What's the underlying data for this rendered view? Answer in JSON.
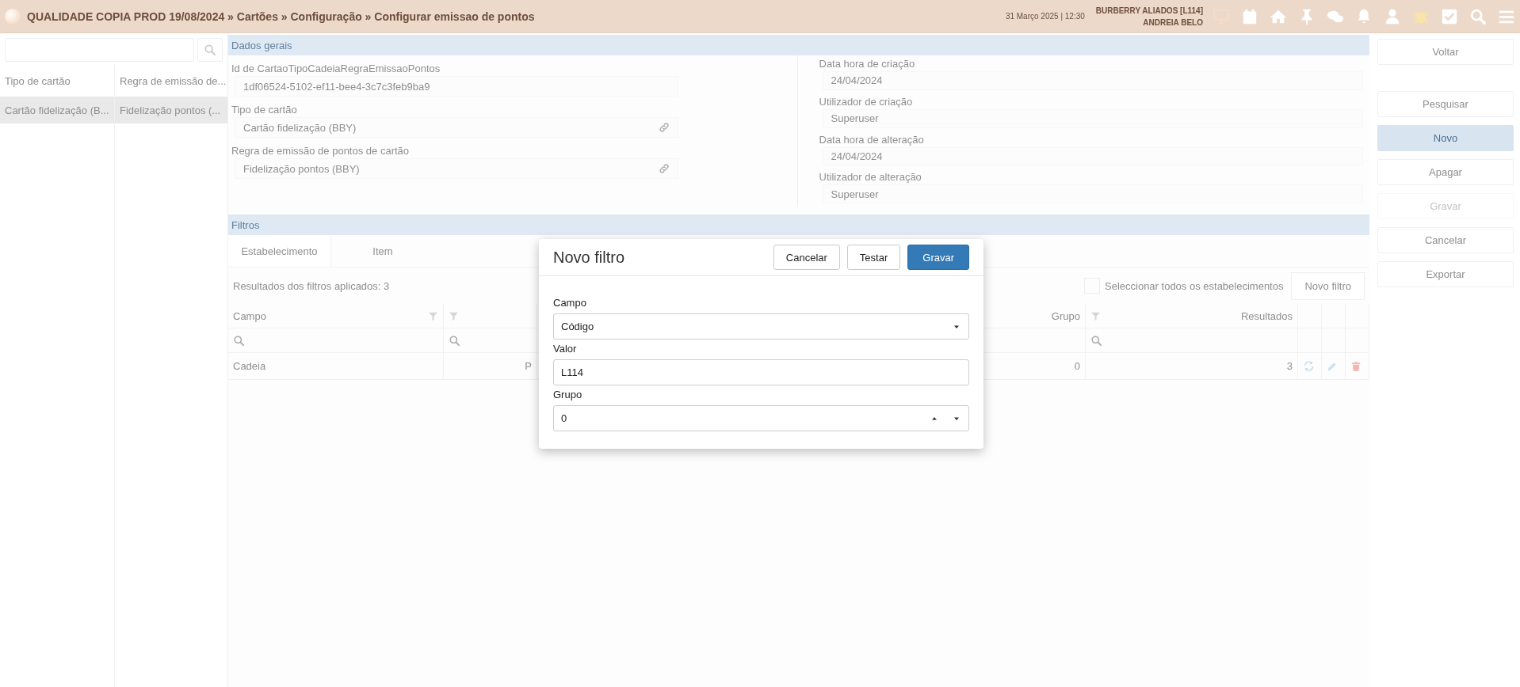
{
  "top_bar": {
    "breadcrumb": "QUALIDADE COPIA PROD 19/08/2024 » Cartões » Configuração » Configurar emissao de pontos",
    "datetime": "31 Março 2025 | 12:30",
    "company": "BURBERRY ALIADOS [L114]",
    "user": "ANDREIA BELO"
  },
  "side_panel": {
    "columns": [
      "Tipo de cartão",
      "Regra de emissão de..."
    ],
    "rows": [
      {
        "cells": [
          "Cartão fidelização (B...",
          "Fidelização pontos (..."
        ],
        "selected": true
      }
    ]
  },
  "dados_gerais": {
    "title": "Dados gerais",
    "left_fields": [
      {
        "label": "Id de CartaoTipoCadeiaRegraEmissaoPontos",
        "value": "1df06524-5102-ef11-bee4-3c7c3feb9ba9",
        "linked": false
      },
      {
        "label": "Tipo de cartão",
        "value": "Cartão fidelização (BBY)",
        "linked": true
      },
      {
        "label": "Regra de emissão de pontos de cartão",
        "value": "Fidelização pontos (BBY)",
        "linked": true
      }
    ],
    "right_fields": [
      {
        "label": "Data hora de criação",
        "value": "24/04/2024"
      },
      {
        "label": "Utilizador de criação",
        "value": "Superuser"
      },
      {
        "label": "Data hora de alteração",
        "value": "24/04/2024"
      },
      {
        "label": "Utilizador de alteração",
        "value": "Superuser"
      }
    ]
  },
  "filtros": {
    "title": "Filtros",
    "tabs": [
      {
        "label": "Estabelecimento",
        "selected": true
      },
      {
        "label": "Item",
        "selected": false
      }
    ],
    "results_text": "Resultados dos filtros aplicados: 3",
    "select_all": {
      "label": "Seleccionar todos os estabelecimentos",
      "checked": false
    },
    "new_filter_button": "Novo filtro",
    "table": {
      "columns": {
        "campo": "Campo",
        "grupo": "Grupo",
        "resultados": "Resultados"
      },
      "rows": [
        {
          "campo": "Cadeia",
          "column_2": "P",
          "grupo": "0",
          "resultados": "3"
        }
      ]
    }
  },
  "actions": [
    {
      "label": "Voltar",
      "selected": false,
      "disabled": false
    },
    {
      "label": "Pesquisar",
      "selected": false,
      "disabled": false
    },
    {
      "label": "Novo",
      "selected": true,
      "disabled": false
    },
    {
      "label": "Apagar",
      "selected": false,
      "disabled": false
    },
    {
      "label": "Gravar",
      "selected": false,
      "disabled": true
    },
    {
      "label": "Cancelar",
      "selected": false,
      "disabled": false
    },
    {
      "label": "Exportar",
      "selected": false,
      "disabled": false
    }
  ],
  "modal": {
    "title": "Novo filtro",
    "buttons": [
      {
        "label": "Cancelar",
        "kind": "default"
      },
      {
        "label": "Testar",
        "kind": "default"
      },
      {
        "label": "Gravar",
        "kind": "primary"
      }
    ],
    "fields": [
      {
        "label": "Campo",
        "kind": "select",
        "value": "Código"
      },
      {
        "label": "Valor",
        "kind": "text",
        "value": "L114"
      },
      {
        "label": "Grupo",
        "kind": "number",
        "value": "0"
      }
    ]
  }
}
